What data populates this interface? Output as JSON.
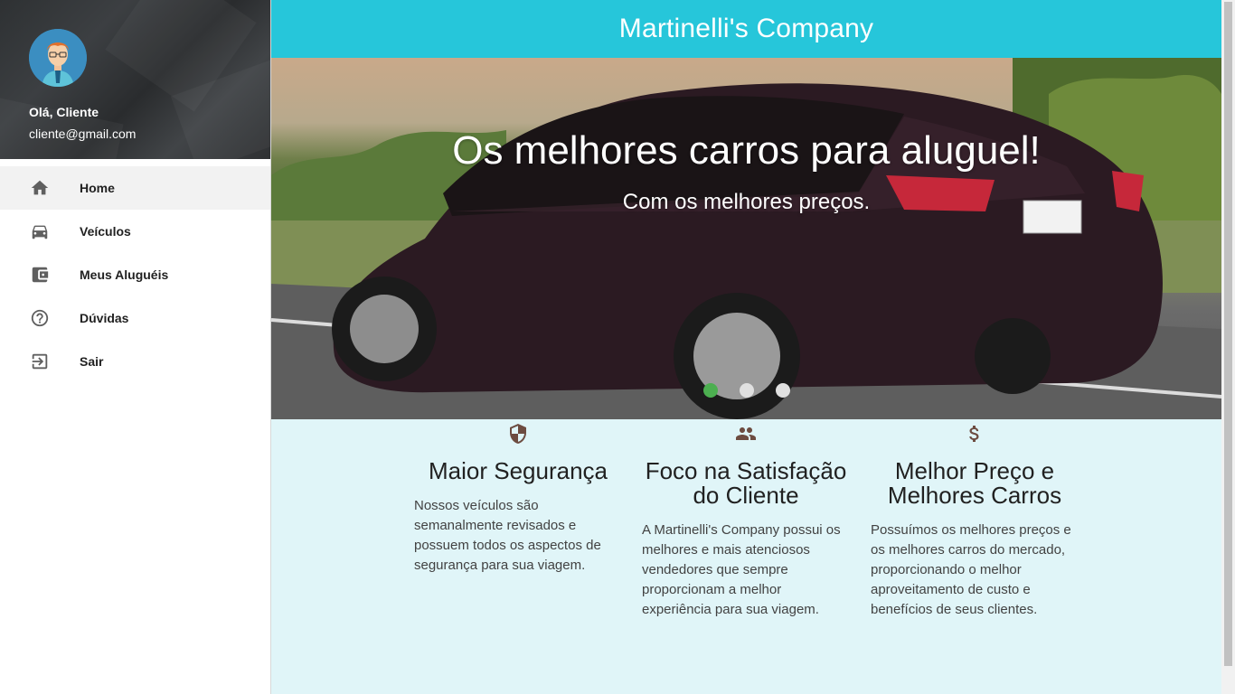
{
  "user": {
    "greeting": "Olá, Cliente",
    "email": "cliente@gmail.com"
  },
  "nav": [
    {
      "label": "Home",
      "icon": "home-icon",
      "active": true
    },
    {
      "label": "Veículos",
      "icon": "car-icon"
    },
    {
      "label": "Meus Aluguéis",
      "icon": "wallet-icon"
    },
    {
      "label": "Dúvidas",
      "icon": "help-circle-icon"
    },
    {
      "label": "Sair",
      "icon": "exit-icon"
    }
  ],
  "header": {
    "title": "Martinelli's Company"
  },
  "hero": {
    "title": "Os melhores carros para aluguel!",
    "subtitle": "Com os melhores preços.",
    "slides": 3,
    "active_slide": 1
  },
  "features": [
    {
      "icon": "shield-icon",
      "title": "Maior Segurança",
      "text": "Nossos veículos são semanalmente revisados e possuem todos os aspectos de segurança para sua viagem."
    },
    {
      "icon": "people-icon",
      "title": "Foco na Satisfação do Cliente",
      "text": "A Martinelli's Company possui os melhores e mais atenciosos vendedores que sempre proporcionam a melhor experiência para sua viagem."
    },
    {
      "icon": "dollar-icon",
      "title": "Melhor Preço e Melhores Carros",
      "text": "Possuímos os melhores preços e os melhores carros do mercado, proporcionando o melhor aproveitamento de custo e benefícios de seus clientes."
    }
  ],
  "colors": {
    "header": "#26c6da",
    "content_bg": "#e0f5f8",
    "active_dot": "#4caf50",
    "icon": "#6d4c41"
  }
}
